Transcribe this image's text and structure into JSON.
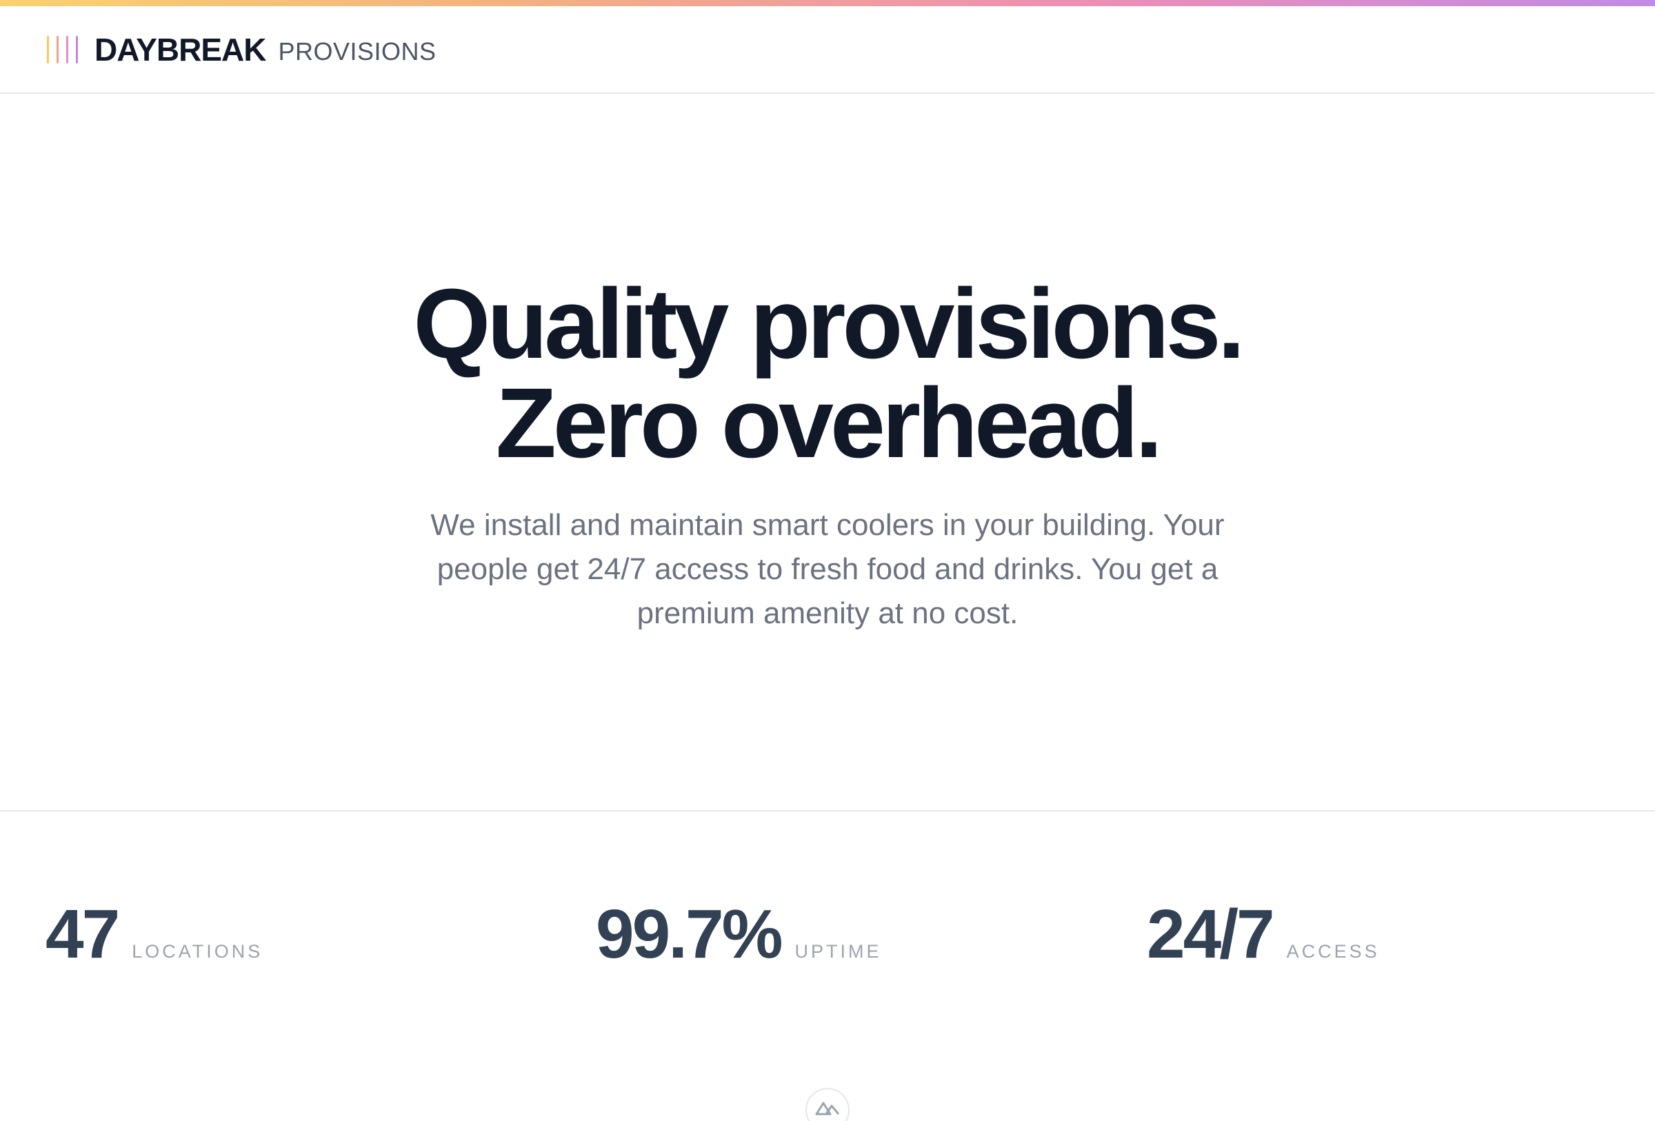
{
  "brand": {
    "name": "DAYBREAK",
    "subtitle": "PROVISIONS",
    "logo_icon": "vertical-bars-logo-icon",
    "logo_colors": [
      "#f9c95c",
      "#f2a089",
      "#e889c9",
      "#c583ea"
    ]
  },
  "hero": {
    "headline_line1": "Quality provisions.",
    "headline_line2": "Zero overhead.",
    "description": "We install and maintain smart coolers in your building. Your people get 24/7 access to fresh food and drinks. You get a premium amenity at no cost."
  },
  "stats": [
    {
      "value": "47",
      "label": "LOCATIONS"
    },
    {
      "value": "99.7%",
      "label": "UPTIME"
    },
    {
      "value": "24/7",
      "label": "ACCESS"
    }
  ],
  "badge": {
    "icon": "nuxt-mountain-icon"
  },
  "colors": {
    "text_dark": "#111827",
    "text_muted": "#6b7280",
    "stat_value": "#334155",
    "stat_label": "#9ca3af",
    "gradient_start": "#f9d26f",
    "gradient_end": "#c08be6"
  }
}
